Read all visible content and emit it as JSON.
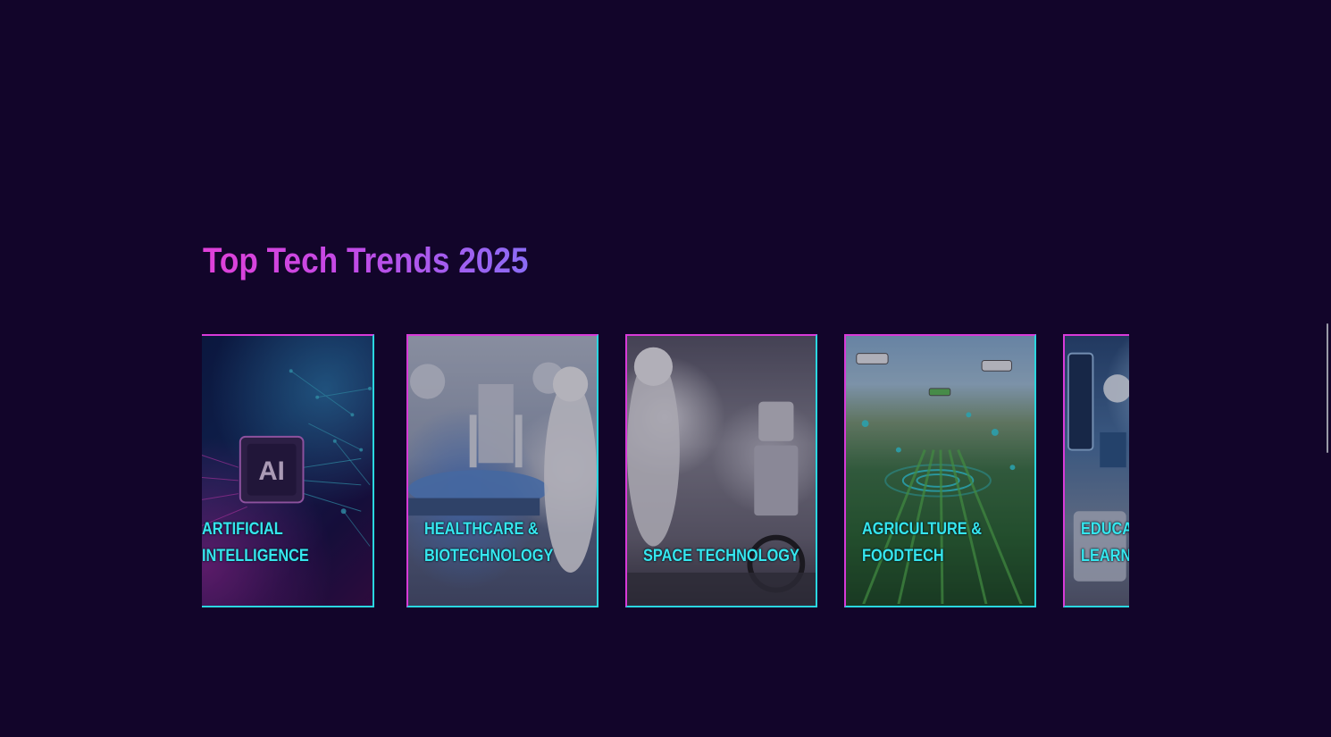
{
  "section": {
    "title": "Top Tech Trends 2025"
  },
  "cards": [
    {
      "line1": "ARTIFICIAL",
      "line2": "INTELLIGENCE",
      "image": "ai-chip-circuit-image"
    },
    {
      "line1": "HEALTHCARE &",
      "line2": "BIOTECHNOLOGY",
      "image": "robot-surgery-image"
    },
    {
      "line1": "",
      "line2": "SPACE TECHNOLOGY",
      "image": "astronaut-robot-image"
    },
    {
      "line1": "AGRICULTURE &",
      "line2": "FOODTECH",
      "image": "drone-farm-field-image"
    },
    {
      "line1": "EDUCA",
      "line2": "LEARN",
      "image": "digital-classroom-image"
    }
  ],
  "colors": {
    "background": "#12052a",
    "card_label": "#36e6ee",
    "border_cyan": "#2ad7e0",
    "border_magenta": "#d83ad8"
  }
}
